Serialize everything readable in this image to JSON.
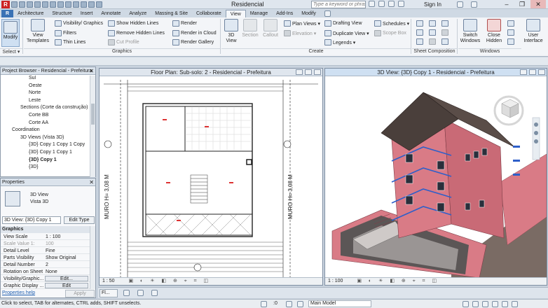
{
  "app": {
    "title": "Residencial",
    "logo": "R",
    "search_placeholder": "Type a keyword or phrase",
    "sign_in": "Sign In",
    "window_controls": [
      "–",
      "❐",
      "✕"
    ]
  },
  "tabs": [
    "R",
    "Architecture",
    "Structure",
    "Insert",
    "Annotate",
    "Analyze",
    "Massing & Site",
    "Collaborate",
    "View",
    "Manage",
    "Add-Ins",
    "Modify"
  ],
  "active_tab": "View",
  "ribbon": {
    "modify": "Modify",
    "select": "Select ▾",
    "view_templates": "View Templates",
    "visibility_graphics": "Visibility/ Graphics",
    "filters": "Filters",
    "thin_lines": "Thin Lines",
    "show_hidden_lines": "Show Hidden Lines",
    "remove_hidden_lines": "Remove Hidden Lines",
    "cut_profile": "Cut Profile",
    "render": "Render",
    "render_in_cloud": "Render in Cloud",
    "render_gallery": "Render Gallery",
    "graphics_label": "Graphics",
    "view_3d": "3D View",
    "section": "Section",
    "callout": "Callout",
    "plan_views": "Plan Views ▾",
    "elevation": "Elevation ▾",
    "legends": "Legends ▾",
    "drafting_view": "Drafting View",
    "duplicate_view": "Duplicate View ▾",
    "schedules": "Schedules ▾",
    "scope_box": "Scope Box",
    "create_label": "Create",
    "sheet_composition_label": "Sheet Composition",
    "switch_windows": "Switch Windows",
    "close_hidden": "Close Hidden",
    "user_interface": "User Interface",
    "windows_label": "Windows"
  },
  "project_browser": {
    "title": "Project Browser - Residencial - Prefeitura",
    "items": [
      {
        "label": "Sul",
        "indent": 3
      },
      {
        "label": "Oeste",
        "indent": 3
      },
      {
        "label": "Norte",
        "indent": 3
      },
      {
        "label": "Leste",
        "indent": 3
      },
      {
        "label": "Sections (Corte da construção)",
        "indent": 2
      },
      {
        "label": "Corte BB",
        "indent": 3
      },
      {
        "label": "Corte AA",
        "indent": 3
      },
      {
        "label": "Coordination",
        "indent": 1
      },
      {
        "label": "3D Views (Vista 3D)",
        "indent": 2
      },
      {
        "label": "{3D} Copy 1 Copy 1 Copy",
        "indent": 3
      },
      {
        "label": "{3D} Copy 1 Copy 1",
        "indent": 3
      },
      {
        "label": "{3D} Copy 1",
        "indent": 3,
        "selected": true
      },
      {
        "label": "{3D}",
        "indent": 3
      }
    ]
  },
  "properties": {
    "title": "Properties",
    "type_name": "3D View",
    "type_sub": "Vista 3D",
    "instance_select": "3D View: {3D} Copy 1",
    "edit_type": "Edit Type",
    "group": "Graphics",
    "rows": [
      {
        "k": "View Scale",
        "v": "1 : 100"
      },
      {
        "k": "Scale Value  1:",
        "v": "100",
        "muted": true
      },
      {
        "k": "Detail Level",
        "v": "Fine"
      },
      {
        "k": "Parts Visibility",
        "v": "Show Original"
      },
      {
        "k": "Detail Number",
        "v": "2"
      },
      {
        "k": "Rotation on Sheet",
        "v": "None"
      },
      {
        "k": "Visibility/Graphic...",
        "v": "Edit...",
        "button": true
      },
      {
        "k": "Graphic Display ...",
        "v": "Edit",
        "button": true
      }
    ],
    "help": "Properties help",
    "apply": "Apply"
  },
  "floor_plan": {
    "title": "Floor Plan: Sub-solo: 2 - Residencial - Prefeitura",
    "scale": "1 : 50",
    "wall_label_left": "MURO H= 3,08 M",
    "wall_label_right": "MURO H= 3,08 M"
  },
  "view_3d": {
    "title": "3D View: {3D} Copy 1 - Residencial - Prefeitura",
    "scale": "1 : 100"
  },
  "view_tabs": [
    "Fl..."
  ],
  "status": {
    "hint": "Click to select, TAB for alternates, CTRL adds, SHIFT unselects.",
    "coord": ":0",
    "model": "Main Model"
  },
  "colors": {
    "house_wall": "#d97b86",
    "roof": "#4a3f3b",
    "ground": "#7a6b64",
    "window_frame": "#2e5fc9"
  }
}
